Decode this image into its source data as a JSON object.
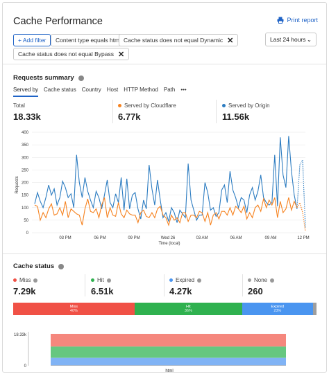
{
  "header": {
    "title": "Cache Performance",
    "print_label": "Print report"
  },
  "filters": {
    "add_label": "+ Add filter",
    "chips": [
      "Content type equals html",
      "Cache status does not equal Dynamic",
      "Cache status does not equal Bypass"
    ],
    "time_range": "Last 24 hours"
  },
  "requests_summary": {
    "title": "Requests summary",
    "tabs": [
      "Served by",
      "Cache status",
      "Country",
      "Host",
      "HTTP Method",
      "Path",
      "•••"
    ],
    "stats": [
      {
        "label": "Total",
        "value": "18.33k"
      },
      {
        "label": "Served by Cloudflare",
        "value": "6.77k",
        "color": "#f6821f"
      },
      {
        "label": "Served by Origin",
        "value": "11.56k",
        "color": "#2c7cc1"
      }
    ]
  },
  "chart_data": {
    "type": "line",
    "y_ticks": [
      "400",
      "350",
      "300",
      "250",
      "200",
      "150",
      "100",
      "50",
      "0"
    ],
    "ylim": [
      0,
      400
    ],
    "ylabel": "Requests",
    "xlabel": "Time (local)",
    "x_ticks": [
      "03 PM",
      "06 PM",
      "09 PM",
      "Wed 26",
      "03 AM",
      "06 AM",
      "09 AM",
      "12 PM"
    ],
    "series": [
      {
        "color": "#2c7cc1",
        "values": [
          115,
          160,
          125,
          100,
          140,
          190,
          150,
          175,
          110,
          140,
          205,
          180,
          140,
          155,
          100,
          310,
          200,
          140,
          220,
          165,
          130,
          100,
          165,
          140,
          95,
          150,
          210,
          120,
          100,
          155,
          120,
          220,
          90,
          215,
          95,
          150,
          160,
          95,
          55,
          130,
          95,
          270,
          175,
          110,
          210,
          130,
          60,
          80,
          45,
          100,
          80,
          40,
          90,
          75,
          60,
          275,
          130,
          90,
          50,
          70,
          70,
          200,
          160,
          90,
          100,
          65,
          80,
          170,
          190,
          120,
          245,
          170,
          140,
          100,
          140,
          130,
          80,
          150,
          180,
          130,
          165,
          230,
          140,
          120,
          110,
          120,
          310,
          105,
          380,
          230,
          180,
          385,
          245,
          150,
          95,
          270,
          290,
          20
        ]
      },
      {
        "color": "#f6821f",
        "values": [
          110,
          105,
          50,
          80,
          60,
          95,
          115,
          70,
          75,
          100,
          70,
          125,
          60,
          95,
          85,
          75,
          70,
          30,
          95,
          135,
          85,
          80,
          95,
          60,
          110,
          140,
          60,
          100,
          70,
          65,
          120,
          75,
          60,
          90,
          75,
          70,
          70,
          40,
          80,
          90,
          65,
          60,
          80,
          60,
          95,
          105,
          70,
          60,
          30,
          70,
          50,
          60,
          40,
          80,
          80,
          45,
          70,
          70,
          60,
          85,
          80,
          45,
          80,
          30,
          70,
          80,
          55,
          85,
          85,
          70,
          100,
          70,
          105,
          95,
          80,
          105,
          55,
          80,
          60,
          100,
          110,
          85,
          135,
          100,
          130,
          110,
          140,
          60,
          125,
          80,
          95,
          140,
          90,
          125,
          100,
          120,
          80,
          5
        ]
      }
    ]
  },
  "cache_status": {
    "title": "Cache status",
    "stats": [
      {
        "label": "Miss",
        "value": "7.29k",
        "color": "#f05146"
      },
      {
        "label": "Hit",
        "value": "6.51k",
        "color": "#2fb14f"
      },
      {
        "label": "Expired",
        "value": "4.27k",
        "color": "#4a95f0"
      },
      {
        "label": "None",
        "value": "260",
        "color": "#9e9e9e"
      }
    ],
    "bar": [
      {
        "label": "Miss",
        "pct": "40%",
        "share": 0.4,
        "color": "#f05146"
      },
      {
        "label": "Hit",
        "pct": "36%",
        "share": 0.355,
        "color": "#2fb14f"
      },
      {
        "label": "Expired",
        "pct": "23%",
        "share": 0.233,
        "color": "#4a95f0"
      },
      {
        "label": "",
        "pct": "",
        "share": 0.012,
        "color": "#9e9e9e"
      }
    ],
    "stack_chart": {
      "y_top": "18.33k",
      "y_bottom": "0",
      "category": "html",
      "bands": [
        {
          "color": "#f5877d",
          "share": 0.4
        },
        {
          "color": "#66c780",
          "share": 0.355
        },
        {
          "color": "#80b3f5",
          "share": 0.233
        },
        {
          "color": "#9e9e9e",
          "share": 0.012
        }
      ]
    }
  }
}
